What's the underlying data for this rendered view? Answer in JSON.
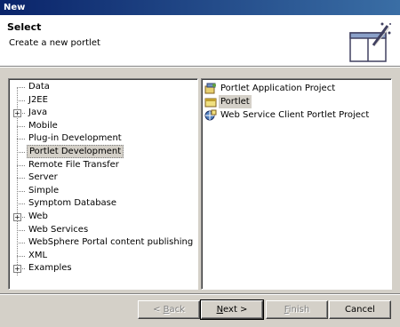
{
  "window": {
    "title": "New"
  },
  "header": {
    "heading": "Select",
    "description": "Create a new portlet"
  },
  "wizard_tree": [
    {
      "label": "Data",
      "expandable": false,
      "selected": false
    },
    {
      "label": "J2EE",
      "expandable": false,
      "selected": false
    },
    {
      "label": "Java",
      "expandable": true,
      "selected": false
    },
    {
      "label": "Mobile",
      "expandable": false,
      "selected": false
    },
    {
      "label": "Plug-in Development",
      "expandable": false,
      "selected": false
    },
    {
      "label": "Portlet Development",
      "expandable": false,
      "selected": true
    },
    {
      "label": "Remote File Transfer",
      "expandable": false,
      "selected": false
    },
    {
      "label": "Server",
      "expandable": false,
      "selected": false
    },
    {
      "label": "Simple",
      "expandable": false,
      "selected": false
    },
    {
      "label": "Symptom Database",
      "expandable": false,
      "selected": false
    },
    {
      "label": "Web",
      "expandable": true,
      "selected": false
    },
    {
      "label": "Web Services",
      "expandable": false,
      "selected": false
    },
    {
      "label": "WebSphere Portal content publishing",
      "expandable": false,
      "selected": false
    },
    {
      "label": "XML",
      "expandable": false,
      "selected": false
    },
    {
      "label": "Examples",
      "expandable": true,
      "selected": false
    }
  ],
  "wizard_list": [
    {
      "label": "Portlet Application Project",
      "icon": "portlet-application-project-icon",
      "selected": false
    },
    {
      "label": "Portlet",
      "icon": "portlet-icon",
      "selected": true
    },
    {
      "label": "Web Service Client Portlet Project",
      "icon": "web-service-client-portlet-icon",
      "selected": false
    }
  ],
  "buttons": {
    "back": {
      "pre": "< ",
      "mnemonic": "B",
      "post": "ack",
      "enabled": false
    },
    "next": {
      "pre": "",
      "mnemonic": "N",
      "post": "ext >",
      "enabled": true
    },
    "finish": {
      "pre": "",
      "mnemonic": "F",
      "post": "inish",
      "enabled": false
    },
    "cancel": {
      "label": "Cancel",
      "enabled": true
    }
  },
  "expander_glyph": "+"
}
